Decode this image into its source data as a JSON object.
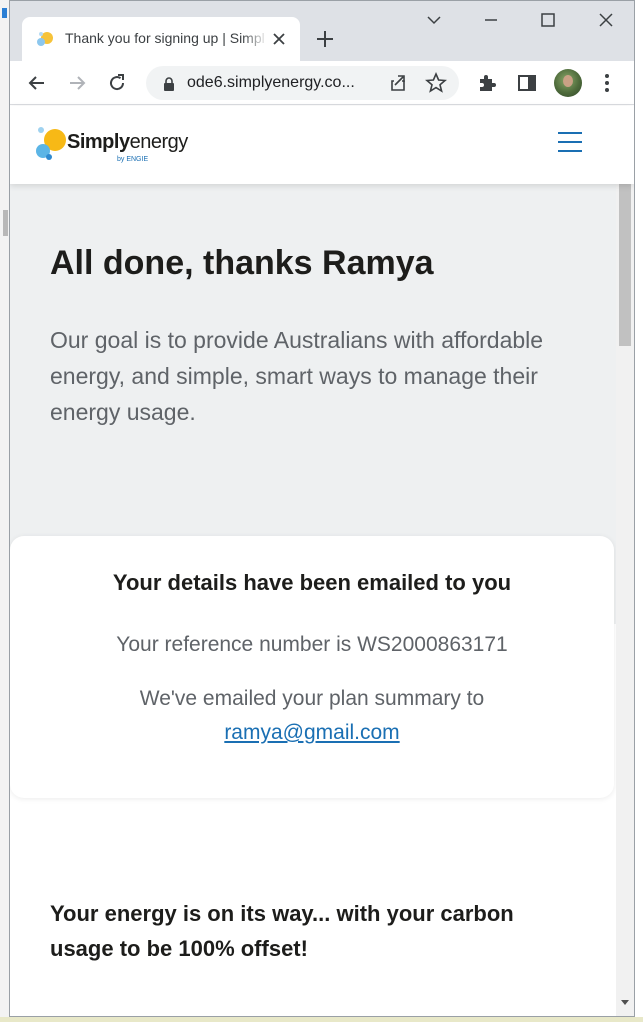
{
  "browser": {
    "tab_title": "Thank you for signing up | Simply Energy",
    "url": "ode6.simplyenergy.co...",
    "icons": [
      "tab-favicon",
      "close-icon",
      "plus-icon",
      "chevron-down-icon",
      "minimize-icon",
      "maximize-icon",
      "close-window-icon",
      "back-arrow-icon",
      "forward-arrow-icon",
      "reload-icon",
      "lock-icon",
      "share-icon",
      "star-icon",
      "puzzle-icon",
      "side-panel-icon",
      "profile-avatar",
      "kebab-menu-icon"
    ]
  },
  "site": {
    "logo_bold": "Simply",
    "logo_light": "energy",
    "logo_sub": "by ENGIE",
    "menu_icon": "hamburger-icon"
  },
  "hero": {
    "title": "All done, thanks Ramya",
    "text": "Our goal is to provide Australians with affordable energy, and simple, smart ways to manage their energy usage."
  },
  "confirmation": {
    "title": "Your details have been emailed to you",
    "reference_text": "Your reference number is WS2000863171",
    "email_line": "We've emailed your plan summary to",
    "email": "ramya@gmail.com"
  },
  "offset": {
    "title": "Your energy is on its way... with your carbon usage to be 100% offset!"
  },
  "colors": {
    "accent": "#1a6fb3",
    "hero_bg": "#eef0f1",
    "text_dark": "#1d1d1b",
    "text_grey": "#5f6368"
  }
}
